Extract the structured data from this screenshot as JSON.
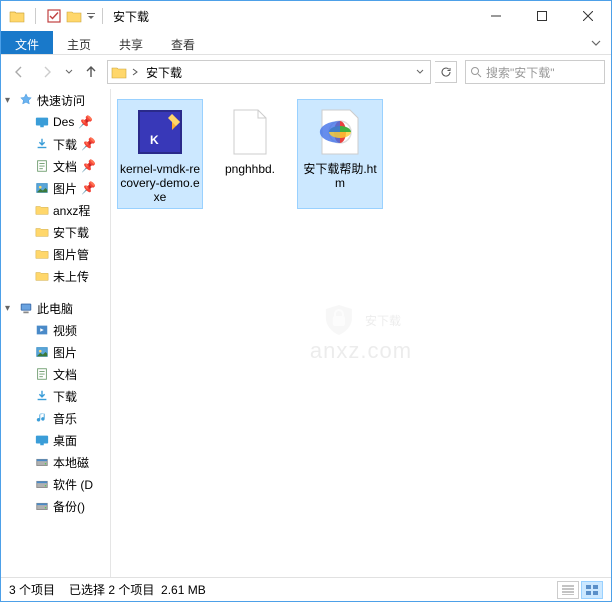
{
  "window": {
    "title": "安下载"
  },
  "tabs": {
    "file": "文件",
    "home": "主页",
    "share": "共享",
    "view": "查看"
  },
  "address": {
    "current": "安下载",
    "refresh_title": "刷新"
  },
  "search": {
    "placeholder": "搜索\"安下载\""
  },
  "sidebar": {
    "quick_access": "快速访问",
    "items1": [
      {
        "label": "Des",
        "icon": "desktop"
      },
      {
        "label": "下载",
        "icon": "downloads"
      },
      {
        "label": "文档",
        "icon": "documents"
      },
      {
        "label": "图片",
        "icon": "pictures"
      },
      {
        "label": "anxz程",
        "icon": "folder"
      },
      {
        "label": "安下载",
        "icon": "folder"
      },
      {
        "label": "图片管",
        "icon": "folder"
      },
      {
        "label": "未上传",
        "icon": "folder"
      }
    ],
    "this_pc": "此电脑",
    "items2": [
      {
        "label": "视频",
        "icon": "videos"
      },
      {
        "label": "图片",
        "icon": "pictures"
      },
      {
        "label": "文档",
        "icon": "documents"
      },
      {
        "label": "下载",
        "icon": "downloads"
      },
      {
        "label": "音乐",
        "icon": "music"
      },
      {
        "label": "桌面",
        "icon": "desktop"
      },
      {
        "label": "本地磁",
        "icon": "disk"
      },
      {
        "label": "软件 (D",
        "icon": "disk"
      },
      {
        "label": "备份()",
        "icon": "disk"
      }
    ]
  },
  "files": [
    {
      "name": "kernel-vmdk-recovery-demo.exe",
      "type": "k-exe",
      "selected": true
    },
    {
      "name": "pnghhbd.",
      "type": "blank",
      "selected": false
    },
    {
      "name": "安下载帮助.htm",
      "type": "htm",
      "selected": true
    }
  ],
  "status": {
    "count": "3 个项目",
    "selection": "已选择 2 个项目",
    "size": "2.61 MB"
  },
  "watermark": {
    "text": "安下载",
    "url": "anxz.com"
  }
}
